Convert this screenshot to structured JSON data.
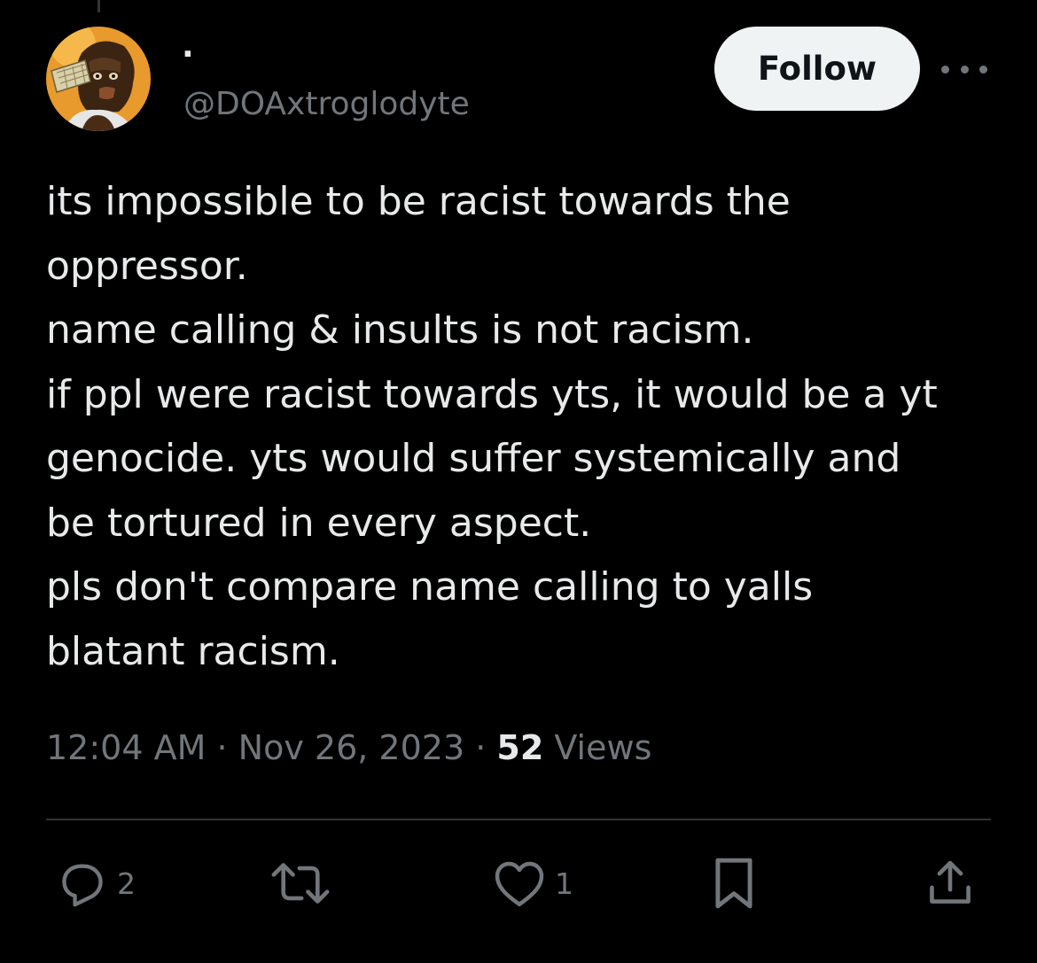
{
  "post": {
    "author": {
      "display_name": "·",
      "handle": "@DOAxtroglodyte",
      "avatar_icon": "caveman-avatar-icon"
    },
    "follow_label": "Follow",
    "more_icon": "more-options-icon",
    "text_lines": [
      "its impossible to be racist towards the",
      "oppressor.",
      "name calling & insults is not racism.",
      "if ppl were racist towards yts, it would be a yt",
      "genocide. yts would suffer systemically and",
      "be tortured in every aspect.",
      "pls don't compare name calling to yalls",
      "blatant racism."
    ],
    "time": "12:04 AM",
    "separator": "·",
    "date": "Nov 26, 2023",
    "views_count": "52",
    "views_label": "Views"
  },
  "actions": {
    "reply": {
      "icon": "reply-icon",
      "count": "2"
    },
    "repost": {
      "icon": "repost-icon",
      "count": ""
    },
    "like": {
      "icon": "heart-icon",
      "count": "1"
    },
    "bookmark": {
      "icon": "bookmark-icon"
    },
    "share": {
      "icon": "share-icon"
    }
  },
  "colors": {
    "background": "#000000",
    "text_primary": "#e7e9ea",
    "text_secondary": "#71767b",
    "follow_button_bg": "#eff3f4",
    "divider": "#2f3336"
  }
}
